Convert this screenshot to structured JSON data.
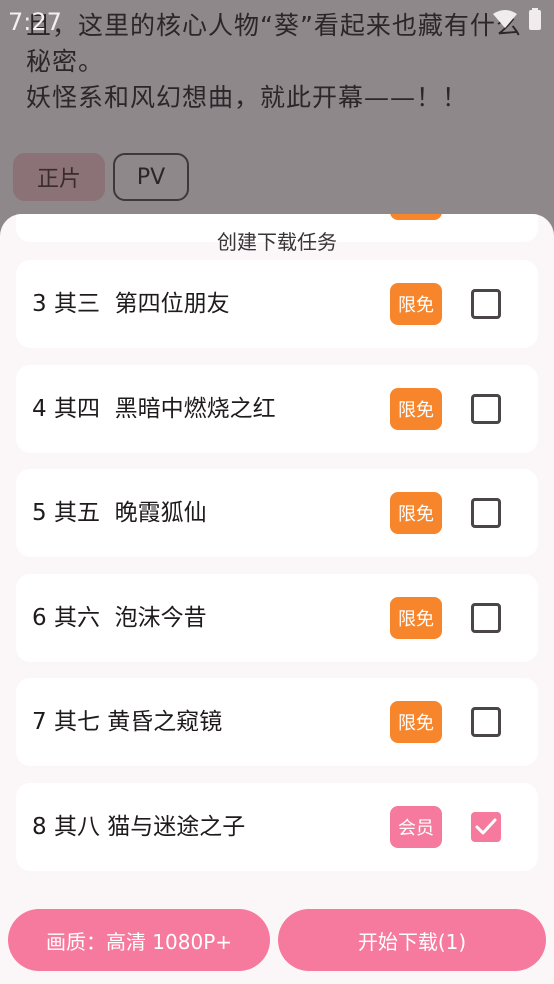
{
  "status_bar": {
    "time": "7:27"
  },
  "background": {
    "synopsis_lines": [
      "且，这里的核心人物“葵”看起来也藏有什么",
      "秘密。",
      "妖怪系和风幻想曲，就此开幕——！！"
    ],
    "tabs": [
      {
        "label": "正片"
      },
      {
        "label": "PV"
      }
    ]
  },
  "sheet": {
    "title": "创建下载任务",
    "episodes": [
      {
        "label": "3 其三  第四位朋友",
        "badge": "限免",
        "checked": false
      },
      {
        "label": "4 其四  黑暗中燃烧之红",
        "badge": "限免",
        "checked": false
      },
      {
        "label": "5 其五  晚霞狐仙",
        "badge": "限免",
        "checked": false
      },
      {
        "label": "6 其六  泡沫今昔",
        "badge": "限免",
        "checked": false
      },
      {
        "label": "7 其七 黄昏之窥镜",
        "badge": "限免",
        "checked": false
      },
      {
        "label": "8 其八 猫与迷途之子",
        "badge": "会员",
        "checked": true
      }
    ],
    "quality_button": "画质：高清 1080P+",
    "download_button": "开始下载(1)"
  },
  "colors": {
    "accent_pink": "#f57a9d",
    "badge_orange": "#f7852b",
    "sheet_bg": "#fbf6f8",
    "card_bg": "#ffffff"
  }
}
